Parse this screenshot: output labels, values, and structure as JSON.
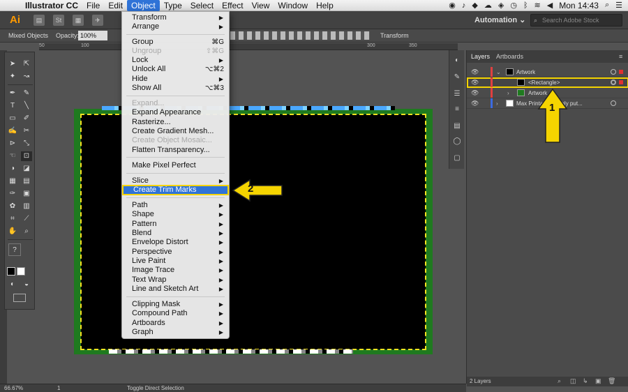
{
  "menubar": {
    "items": [
      "Illustrator CC",
      "File",
      "Edit",
      "Object",
      "Type",
      "Select",
      "Effect",
      "View",
      "Window",
      "Help"
    ],
    "clock": "Mon 14:43"
  },
  "appbar": {
    "logo": "Ai",
    "stock_icon": "St",
    "workspace": "Automation",
    "stock_placeholder": "Search Adobe Stock"
  },
  "controlbar": {
    "selection": "Mixed Objects",
    "opacity_label": "Opacity:",
    "opacity_value": "100%",
    "transform": "Transform"
  },
  "ruler": {
    "ticks": [
      "50",
      "100",
      "300",
      "350"
    ]
  },
  "object_menu": {
    "items": [
      {
        "label": "Transform",
        "arrow": "▶"
      },
      {
        "label": "Arrange",
        "arrow": "▶"
      },
      {
        "label": "Group",
        "shortcut": "⌘G"
      },
      {
        "label": "Ungroup",
        "shortcut": "⇧⌘G"
      },
      {
        "label": "Lock",
        "arrow": "▶"
      },
      {
        "label": "Unlock All",
        "shortcut": "⌥⌘2"
      },
      {
        "label": "Hide",
        "arrow": "▶"
      },
      {
        "label": "Show All",
        "shortcut": "⌥⌘3"
      },
      {
        "label": "Expand..."
      },
      {
        "label": "Expand Appearance"
      },
      {
        "label": "Rasterize..."
      },
      {
        "label": "Create Gradient Mesh..."
      },
      {
        "label": "Create Object Mosaic..."
      },
      {
        "label": "Flatten Transparency..."
      },
      {
        "label": "Make Pixel Perfect"
      },
      {
        "label": "Slice",
        "arrow": "▶"
      },
      {
        "label": "Create Trim Marks"
      },
      {
        "label": "Path",
        "arrow": "▶"
      },
      {
        "label": "Shape",
        "arrow": "▶"
      },
      {
        "label": "Pattern",
        "arrow": "▶"
      },
      {
        "label": "Blend",
        "arrow": "▶"
      },
      {
        "label": "Envelope Distort",
        "arrow": "▶"
      },
      {
        "label": "Perspective",
        "arrow": "▶"
      },
      {
        "label": "Live Paint",
        "arrow": "▶"
      },
      {
        "label": "Image Trace",
        "arrow": "▶"
      },
      {
        "label": "Text Wrap",
        "arrow": "▶"
      },
      {
        "label": "Line and Sketch Art",
        "arrow": "▶"
      },
      {
        "label": "Clipping Mask",
        "arrow": "▶"
      },
      {
        "label": "Compound Path",
        "arrow": "▶"
      },
      {
        "label": "Artboards",
        "arrow": "▶"
      },
      {
        "label": "Graph",
        "arrow": "▶"
      }
    ]
  },
  "layers_panel": {
    "tabs": [
      "Layers",
      "Artboards"
    ],
    "rows": [
      {
        "name": "Artwork"
      },
      {
        "name": "<Rectangle>"
      },
      {
        "name": "Artwork"
      },
      {
        "name": "Max Printable ... only put..."
      }
    ],
    "count": "2 Layers"
  },
  "statusbar": {
    "zoom": "66.67%",
    "page": "1",
    "tool_hint": "Toggle Direct Selection"
  },
  "callouts": {
    "one": "1",
    "two": "2"
  },
  "colors": {
    "highlight": "#2f73d7",
    "callout": "#f5d400",
    "selection": "#f5e320"
  }
}
